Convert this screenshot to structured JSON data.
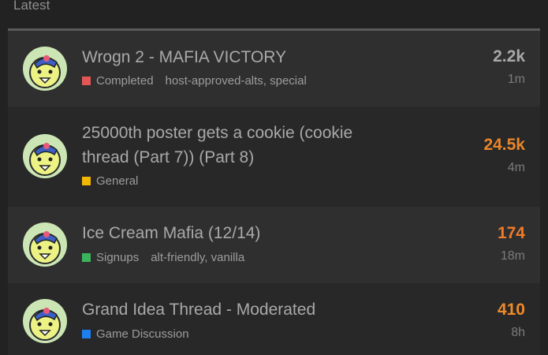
{
  "section": {
    "title": "Latest"
  },
  "topics": [
    {
      "title": "Wrogn 2 - MAFIA VICTORY",
      "category": "Completed",
      "category_color": "#e45555",
      "tags": "host-approved-alts, special",
      "replies": "2.2k",
      "replies_color": "#a9a9a9",
      "activity": "1m"
    },
    {
      "title": "25000th poster gets a cookie (cookie thread (Part 7)) (Part 8)",
      "category": "General",
      "category_color": "#f2b705",
      "tags": "",
      "replies": "24.5k",
      "replies_color": "#e8862a",
      "activity": "4m"
    },
    {
      "title": "Ice Cream Mafia (12/14)",
      "category": "Signups",
      "category_color": "#3bb55d",
      "tags": "alt-friendly, vanilla",
      "replies": "174",
      "replies_color": "#f07b2a",
      "activity": "18m"
    },
    {
      "title": "Grand Idea Thread - Moderated",
      "category": "Game Discussion",
      "category_color": "#1d7ff0",
      "tags": "",
      "replies": "410",
      "replies_color": "#f08a2a",
      "activity": "8h"
    }
  ],
  "icons": {
    "avatar": "pear-mascot-avatar"
  }
}
